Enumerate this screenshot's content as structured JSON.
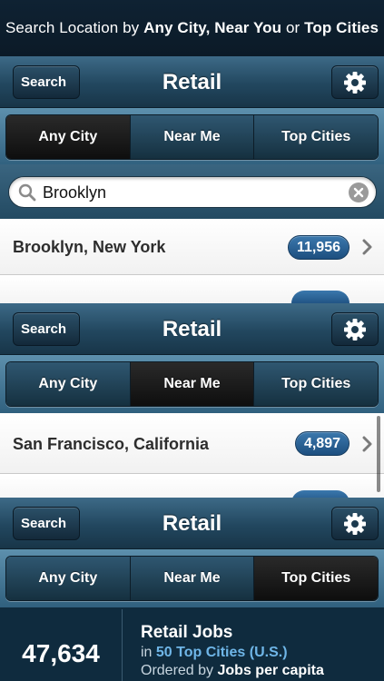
{
  "banner": {
    "prefix": "Search Location by",
    "opt1": "Any City,",
    "opt2": "Near You",
    "or": "or",
    "opt3": "Top Cities"
  },
  "nav": {
    "back_label": "Search",
    "title": "Retail",
    "settings_icon": "gear-icon"
  },
  "segments": [
    "Any City",
    "Near Me",
    "Top Cities"
  ],
  "screen1": {
    "active_segment": "Any City",
    "search_value": "Brooklyn",
    "result": {
      "name": "Brooklyn, New York",
      "count": "11,956"
    }
  },
  "screen2": {
    "active_segment": "Near Me",
    "result": {
      "name": "San Francisco, California",
      "count": "4,897"
    }
  },
  "screen3": {
    "active_segment": "Top Cities",
    "stats": {
      "total": "47,634",
      "heading": "Retail Jobs",
      "line1_prefix": "in",
      "line1_value": "50 Top Cities (U.S.)",
      "line2_prefix": "Ordered by",
      "line2_value": "Jobs per capita"
    }
  },
  "colors": {
    "badge": "#2a64a0",
    "nav": "#22475f",
    "segment_active": "#111111"
  }
}
